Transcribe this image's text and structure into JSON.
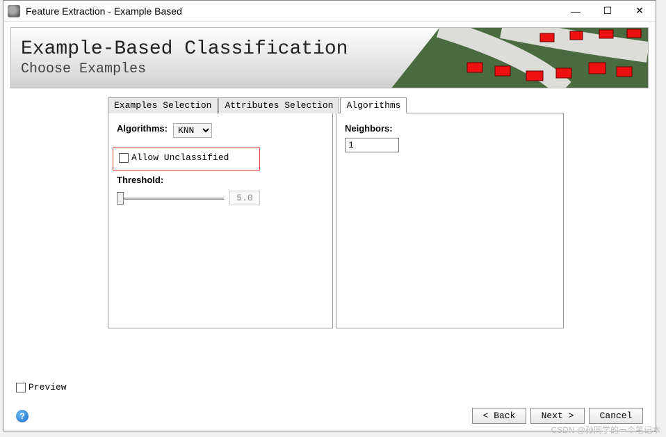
{
  "window": {
    "title": "Feature Extraction - Example Based"
  },
  "banner": {
    "title": "Example-Based Classification",
    "subtitle": "Choose Examples"
  },
  "tabs": {
    "examples": "Examples Selection",
    "attributes": "Attributes Selection",
    "algorithms": "Algorithms"
  },
  "left_panel": {
    "algorithms_label": "Algorithms:",
    "algorithm_value": "KNN",
    "allow_unclassified_label": "Allow Unclassified",
    "allow_unclassified_checked": false,
    "threshold_label": "Threshold:",
    "threshold_value": "5.0"
  },
  "right_panel": {
    "neighbors_label": "Neighbors:",
    "neighbors_value": "1"
  },
  "footer": {
    "preview_label": "Preview",
    "preview_checked": false,
    "back_label": "< Back",
    "next_label": "Next >",
    "cancel_label": "Cancel"
  },
  "watermark": "CSDN @孙同学的一个笔记本"
}
